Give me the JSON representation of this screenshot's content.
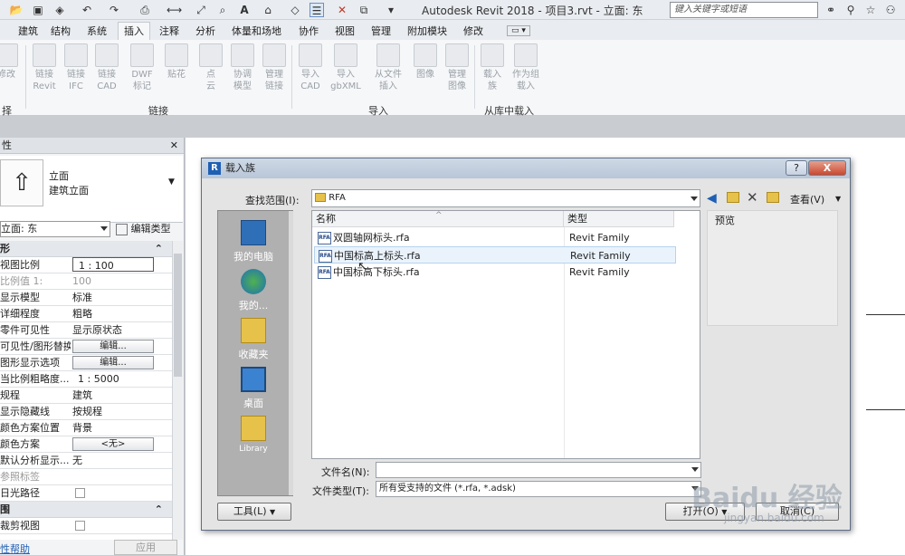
{
  "app": {
    "title": "Autodesk Revit 2018 -    项目3.rvt - 立面: 东",
    "search_placeholder": "键入关键字或短语"
  },
  "ribbon": {
    "tabs": [
      "建筑",
      "结构",
      "系统",
      "插入",
      "注释",
      "分析",
      "体量和场地",
      "协作",
      "视图",
      "管理",
      "附加模块",
      "修改"
    ],
    "active_tab": "插入",
    "buttons": [
      {
        "label1": "修改",
        "label2": ""
      },
      {
        "label1": "链接",
        "label2": "Revit"
      },
      {
        "label1": "链接",
        "label2": "IFC"
      },
      {
        "label1": "链接",
        "label2": "CAD"
      },
      {
        "label1": "DWF",
        "label2": "标记"
      },
      {
        "label1": "贴花",
        "label2": ""
      },
      {
        "label1": "点",
        "label2": "云"
      },
      {
        "label1": "协调",
        "label2": "模型"
      },
      {
        "label1": "管理",
        "label2": "链接"
      },
      {
        "label1": "导入",
        "label2": "CAD"
      },
      {
        "label1": "导入",
        "label2": "gbXML"
      },
      {
        "label1": "从文件",
        "label2": "插入"
      },
      {
        "label1": "图像",
        "label2": ""
      },
      {
        "label1": "管理",
        "label2": "图像"
      },
      {
        "label1": "载入",
        "label2": "族"
      },
      {
        "label1": "作为组",
        "label2": "载入"
      }
    ],
    "panels": [
      "择",
      "链接",
      "导入",
      "从库中载入"
    ]
  },
  "properties": {
    "header": "性",
    "type_name": "立面",
    "type_sub": "建筑立面",
    "selector": "立面: 东",
    "edit_type": "编辑类型",
    "section_graphics": "形",
    "rows": [
      {
        "k": "视图比例",
        "v": "1 : 100"
      },
      {
        "k": "比例值 1:",
        "v": "100"
      },
      {
        "k": "显示模型",
        "v": "标准"
      },
      {
        "k": "详细程度",
        "v": "粗略"
      },
      {
        "k": "零件可见性",
        "v": "显示原状态"
      },
      {
        "k": "可见性/图形替换",
        "v": "编辑..."
      },
      {
        "k": "图形显示选项",
        "v": "编辑..."
      },
      {
        "k": "当比例粗略度...",
        "v": "1 : 5000"
      },
      {
        "k": "规程",
        "v": "建筑"
      },
      {
        "k": "显示隐藏线",
        "v": "按规程"
      },
      {
        "k": "颜色方案位置",
        "v": "背景"
      },
      {
        "k": "颜色方案",
        "v": "<无>"
      },
      {
        "k": "默认分析显示...",
        "v": "无"
      },
      {
        "k": "参照标签",
        "v": ""
      },
      {
        "k": "日光路径",
        "v": ""
      }
    ],
    "section_range": "围",
    "crop_view": "裁剪视图",
    "help_link": "性帮助",
    "apply": "应用"
  },
  "dialog": {
    "title": "载入族",
    "lookin_label": "查找范围(I):",
    "lookin_value": "RFA",
    "view_label": "查看(V)",
    "places": [
      "我的电脑",
      "我的...",
      "收藏夹",
      "桌面",
      "Library"
    ],
    "col_name": "名称",
    "col_type": "类型",
    "files": [
      {
        "name": "双圆轴网标头.rfa",
        "type": "Revit Family"
      },
      {
        "name": "中国标高上标头.rfa",
        "type": "Revit Family"
      },
      {
        "name": "中国标高下标头.rfa",
        "type": "Revit Family"
      }
    ],
    "file_icon_text": "RFA",
    "preview_label": "预览",
    "filename_label": "文件名(N):",
    "filename_value": "",
    "filetype_label": "文件类型(T):",
    "filetype_value": "所有受支持的文件 (*.rfa, *.adsk)",
    "tools_label": "工具(L)",
    "open_label": "打开(O)",
    "cancel_label": "取消(C)",
    "help_btn": "?",
    "close_btn": "X"
  },
  "watermark": {
    "line1": "Baidu 经验",
    "line2": "jingyan.baidu.com"
  },
  "colors": {
    "accent": "#1f5fb4",
    "dialog_title": "#c3cfdf",
    "places_bg": "#b0b0b0",
    "watermark": "#8e9aa8"
  }
}
